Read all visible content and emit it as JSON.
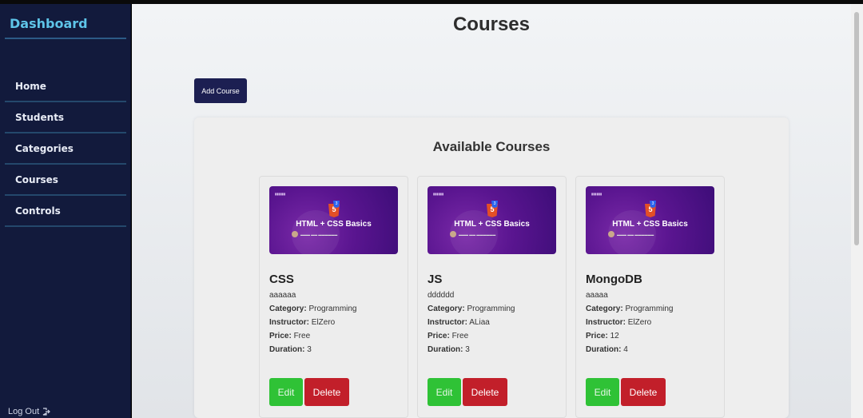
{
  "sidebar": {
    "brand": "Dashboard",
    "items": [
      {
        "label": "Home"
      },
      {
        "label": "Students"
      },
      {
        "label": "Categories"
      },
      {
        "label": "Courses"
      },
      {
        "label": "Controls"
      }
    ],
    "logout_label": "Log Out"
  },
  "main": {
    "title": "Courses",
    "add_button": "Add Course",
    "panel_title": "Available Courses",
    "labels": {
      "category": "Category:",
      "instructor": "Instructor:",
      "price": "Price:",
      "duration": "Duration:",
      "edit": "Edit",
      "delete": "Delete"
    },
    "courses": [
      {
        "thumb_title": "HTML + CSS Basics",
        "name": "CSS",
        "description": "aaaaaa",
        "category": "Programming",
        "instructor": "ElZero",
        "price": "Free",
        "duration": "3"
      },
      {
        "thumb_title": "HTML + CSS Basics",
        "name": "JS",
        "description": "dddddd",
        "category": "Programming",
        "instructor": "ALiaa",
        "price": "Free",
        "duration": "3"
      },
      {
        "thumb_title": "HTML + CSS Basics",
        "name": "MongoDB",
        "description": "aaaaa",
        "category": "Programming",
        "instructor": "ElZero",
        "price": "12",
        "duration": "4"
      }
    ]
  },
  "colors": {
    "sidebar_bg": "#121a3c",
    "brand_text": "#5ec4e8",
    "add_button_bg": "#1c1f52",
    "edit_button_bg": "#2fc236",
    "delete_button_bg": "#c21f2a"
  }
}
